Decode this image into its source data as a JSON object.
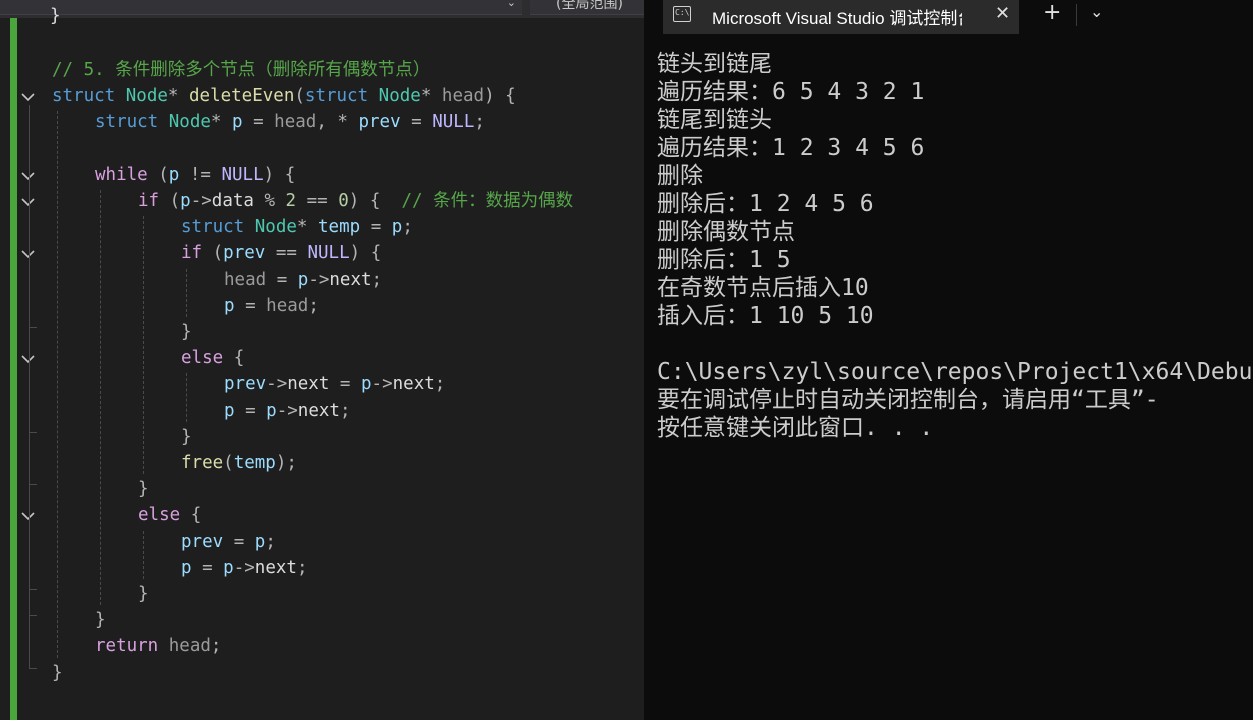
{
  "editor": {
    "scope_dropdown": "(全局范围)",
    "lines": [
      {
        "tokens": [
          {
            "c": "c",
            "s": "// 5. 条件删除多个节点（删除所有偶数节点）"
          }
        ]
      },
      {
        "tokens": [
          {
            "c": "k",
            "s": "struct"
          },
          {
            "c": "",
            "s": " "
          },
          {
            "c": "t",
            "s": "Node"
          },
          {
            "c": "o",
            "s": "* "
          },
          {
            "c": "f",
            "s": "deleteEven"
          },
          {
            "c": "o",
            "s": "("
          },
          {
            "c": "k",
            "s": "struct"
          },
          {
            "c": "",
            "s": " "
          },
          {
            "c": "t",
            "s": "Node"
          },
          {
            "c": "o",
            "s": "* "
          },
          {
            "c": "p",
            "s": "head"
          },
          {
            "c": "o",
            "s": ") {"
          }
        ]
      },
      {
        "tokens": [
          {
            "c": "k",
            "s": "struct"
          },
          {
            "c": "",
            "s": " "
          },
          {
            "c": "t",
            "s": "Node"
          },
          {
            "c": "o",
            "s": "* "
          },
          {
            "c": "v",
            "s": "p"
          },
          {
            "c": "o",
            "s": " = "
          },
          {
            "c": "p",
            "s": "head"
          },
          {
            "c": "o",
            "s": ", * "
          },
          {
            "c": "v",
            "s": "prev"
          },
          {
            "c": "o",
            "s": " = "
          },
          {
            "c": "m",
            "s": "NULL"
          },
          {
            "c": "o",
            "s": ";"
          }
        ]
      },
      {
        "tokens": []
      },
      {
        "tokens": [
          {
            "c": "ctl",
            "s": "while"
          },
          {
            "c": "o",
            "s": " ("
          },
          {
            "c": "v",
            "s": "p"
          },
          {
            "c": "o",
            "s": " != "
          },
          {
            "c": "m",
            "s": "NULL"
          },
          {
            "c": "o",
            "s": ") {"
          }
        ]
      },
      {
        "tokens": [
          {
            "c": "ctl",
            "s": "if"
          },
          {
            "c": "o",
            "s": " ("
          },
          {
            "c": "v",
            "s": "p"
          },
          {
            "c": "o",
            "s": "->"
          },
          {
            "c": "",
            "s": "data"
          },
          {
            "c": "o",
            "s": " % "
          },
          {
            "c": "n",
            "s": "2"
          },
          {
            "c": "o",
            "s": " == "
          },
          {
            "c": "n",
            "s": "0"
          },
          {
            "c": "o",
            "s": ") {  "
          },
          {
            "c": "c",
            "s": "// 条件：数据为偶数"
          }
        ]
      },
      {
        "tokens": [
          {
            "c": "k",
            "s": "struct"
          },
          {
            "c": "",
            "s": " "
          },
          {
            "c": "t",
            "s": "Node"
          },
          {
            "c": "o",
            "s": "* "
          },
          {
            "c": "v",
            "s": "temp"
          },
          {
            "c": "o",
            "s": " = "
          },
          {
            "c": "v",
            "s": "p"
          },
          {
            "c": "o",
            "s": ";"
          }
        ]
      },
      {
        "tokens": [
          {
            "c": "ctl",
            "s": "if"
          },
          {
            "c": "o",
            "s": " ("
          },
          {
            "c": "v",
            "s": "prev"
          },
          {
            "c": "o",
            "s": " == "
          },
          {
            "c": "m",
            "s": "NULL"
          },
          {
            "c": "o",
            "s": ") {"
          }
        ]
      },
      {
        "tokens": [
          {
            "c": "p",
            "s": "head"
          },
          {
            "c": "o",
            "s": " = "
          },
          {
            "c": "v",
            "s": "p"
          },
          {
            "c": "o",
            "s": "->"
          },
          {
            "c": "",
            "s": "next"
          },
          {
            "c": "o",
            "s": ";"
          }
        ]
      },
      {
        "tokens": [
          {
            "c": "v",
            "s": "p"
          },
          {
            "c": "o",
            "s": " = "
          },
          {
            "c": "p",
            "s": "head"
          },
          {
            "c": "o",
            "s": ";"
          }
        ]
      },
      {
        "tokens": [
          {
            "c": "o",
            "s": "}"
          }
        ]
      },
      {
        "tokens": [
          {
            "c": "ctl",
            "s": "else"
          },
          {
            "c": "o",
            "s": " {"
          }
        ]
      },
      {
        "tokens": [
          {
            "c": "v",
            "s": "prev"
          },
          {
            "c": "o",
            "s": "->"
          },
          {
            "c": "",
            "s": "next"
          },
          {
            "c": "o",
            "s": " = "
          },
          {
            "c": "v",
            "s": "p"
          },
          {
            "c": "o",
            "s": "->"
          },
          {
            "c": "",
            "s": "next"
          },
          {
            "c": "o",
            "s": ";"
          }
        ]
      },
      {
        "tokens": [
          {
            "c": "v",
            "s": "p"
          },
          {
            "c": "o",
            "s": " = "
          },
          {
            "c": "v",
            "s": "p"
          },
          {
            "c": "o",
            "s": "->"
          },
          {
            "c": "",
            "s": "next"
          },
          {
            "c": "o",
            "s": ";"
          }
        ]
      },
      {
        "tokens": [
          {
            "c": "o",
            "s": "}"
          }
        ]
      },
      {
        "tokens": [
          {
            "c": "f",
            "s": "free"
          },
          {
            "c": "o",
            "s": "("
          },
          {
            "c": "v",
            "s": "temp"
          },
          {
            "c": "o",
            "s": ");"
          }
        ]
      },
      {
        "tokens": [
          {
            "c": "o",
            "s": "}"
          }
        ]
      },
      {
        "tokens": [
          {
            "c": "ctl",
            "s": "else"
          },
          {
            "c": "o",
            "s": " {"
          }
        ]
      },
      {
        "tokens": [
          {
            "c": "v",
            "s": "prev"
          },
          {
            "c": "o",
            "s": " = "
          },
          {
            "c": "v",
            "s": "p"
          },
          {
            "c": "o",
            "s": ";"
          }
        ]
      },
      {
        "tokens": [
          {
            "c": "v",
            "s": "p"
          },
          {
            "c": "o",
            "s": " = "
          },
          {
            "c": "v",
            "s": "p"
          },
          {
            "c": "o",
            "s": "->"
          },
          {
            "c": "",
            "s": "next"
          },
          {
            "c": "o",
            "s": ";"
          }
        ]
      },
      {
        "tokens": [
          {
            "c": "o",
            "s": "}"
          }
        ]
      },
      {
        "tokens": [
          {
            "c": "o",
            "s": "}"
          }
        ]
      },
      {
        "tokens": [
          {
            "c": "ctl",
            "s": "return"
          },
          {
            "c": "o",
            "s": " "
          },
          {
            "c": "p",
            "s": "head"
          },
          {
            "c": "o",
            "s": ";"
          }
        ]
      },
      {
        "tokens": [
          {
            "c": "o",
            "s": "}"
          }
        ]
      }
    ],
    "top_fragment": "}"
  },
  "console": {
    "tab_title": "Microsoft Visual Studio 调试控制台",
    "tab_close": "✕",
    "new_tab": "+",
    "tab_menu": "⌄",
    "output": [
      "链头到链尾",
      "遍历结果：6 5 4 3 2 1",
      "链尾到链头",
      "遍历结果：1 2 3 4 5 6",
      "删除",
      "删除后：1 2 4 5 6",
      "删除偶数节点",
      "删除后：1 5",
      "在奇数节点后插入10",
      "插入后：1 10 5 10",
      "",
      "C:\\Users\\zyl\\source\\repos\\Project1\\x64\\Debu",
      "要在调试停止时自动关闭控制台，请启用“工具”-",
      "按任意键关闭此窗口. . ."
    ]
  }
}
